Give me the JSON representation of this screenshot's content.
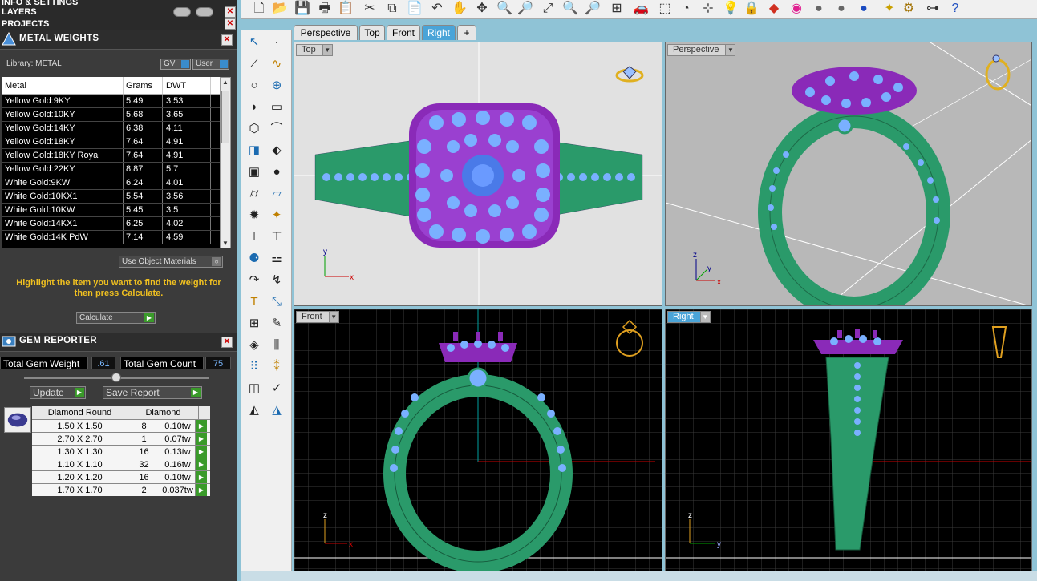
{
  "left_panel": {
    "info_settings": "INFO & SETTINGS",
    "layers": "LAYERS",
    "projects": "PROJECTS",
    "metal_weights": {
      "title": "METAL WEIGHTS",
      "library_label": "Library: METAL",
      "gv_label": "GV",
      "user_label": "User",
      "columns": [
        "Metal",
        "Grams",
        "DWT"
      ],
      "rows": [
        [
          "Yellow Gold:9KY",
          "5.49",
          "3.53"
        ],
        [
          "Yellow Gold:10KY",
          "5.68",
          "3.65"
        ],
        [
          "Yellow Gold:14KY",
          "6.38",
          "4.11"
        ],
        [
          "Yellow Gold:18KY",
          "7.64",
          "4.91"
        ],
        [
          "Yellow Gold:18KY Royal",
          "7.64",
          "4.91"
        ],
        [
          "Yellow Gold:22KY",
          "8.87",
          "5.7"
        ],
        [
          "White Gold:9KW",
          "6.24",
          "4.01"
        ],
        [
          "White Gold:10KX1",
          "5.54",
          "3.56"
        ],
        [
          "White Gold:10KW",
          "5.45",
          "3.5"
        ],
        [
          "White Gold:14KX1",
          "6.25",
          "4.02"
        ],
        [
          "White Gold:14K PdW",
          "7.14",
          "4.59"
        ]
      ],
      "use_object_materials": "Use Object Materials",
      "highlight_text": "Highlight the item you want to find the weight for then press Calculate.",
      "calculate_label": "Calculate"
    },
    "gem_reporter": {
      "title": "GEM REPORTER",
      "total_weight_label": "Total Gem Weight",
      "total_weight_value": ".61",
      "total_count_label": "Total Gem Count",
      "total_count_value": "75",
      "update_label": "Update",
      "save_report_label": "Save Report",
      "header": [
        "Diamond Round",
        "Diamond"
      ],
      "rows": [
        [
          "1.50 X 1.50",
          "8",
          "0.10tw"
        ],
        [
          "2.70 X 2.70",
          "1",
          "0.07tw"
        ],
        [
          "1.30 X 1.30",
          "16",
          "0.13tw"
        ],
        [
          "1.10 X 1.10",
          "32",
          "0.16tw"
        ],
        [
          "1.20 X 1.20",
          "16",
          "0.10tw"
        ],
        [
          "1.70 X 1.70",
          "2",
          "0.037tw"
        ]
      ]
    }
  },
  "tabs": [
    "Perspective",
    "Top",
    "Front",
    "Right"
  ],
  "active_tab": "Right",
  "viewports": {
    "top": "Top",
    "perspective": "Perspective",
    "front": "Front",
    "right": "Right"
  },
  "axes": {
    "top": [
      "x",
      "y"
    ],
    "persp": [
      "x",
      "y",
      "z"
    ],
    "front": [
      "x",
      "z"
    ],
    "right": [
      "y",
      "z"
    ]
  },
  "colors": {
    "metal_green": "#2a9a6a",
    "prong_purple": "#8a2ab8",
    "stone_blue": "#7ab0ff",
    "viewport_grid": "#000000",
    "active_tab": "#4aa4d8"
  }
}
